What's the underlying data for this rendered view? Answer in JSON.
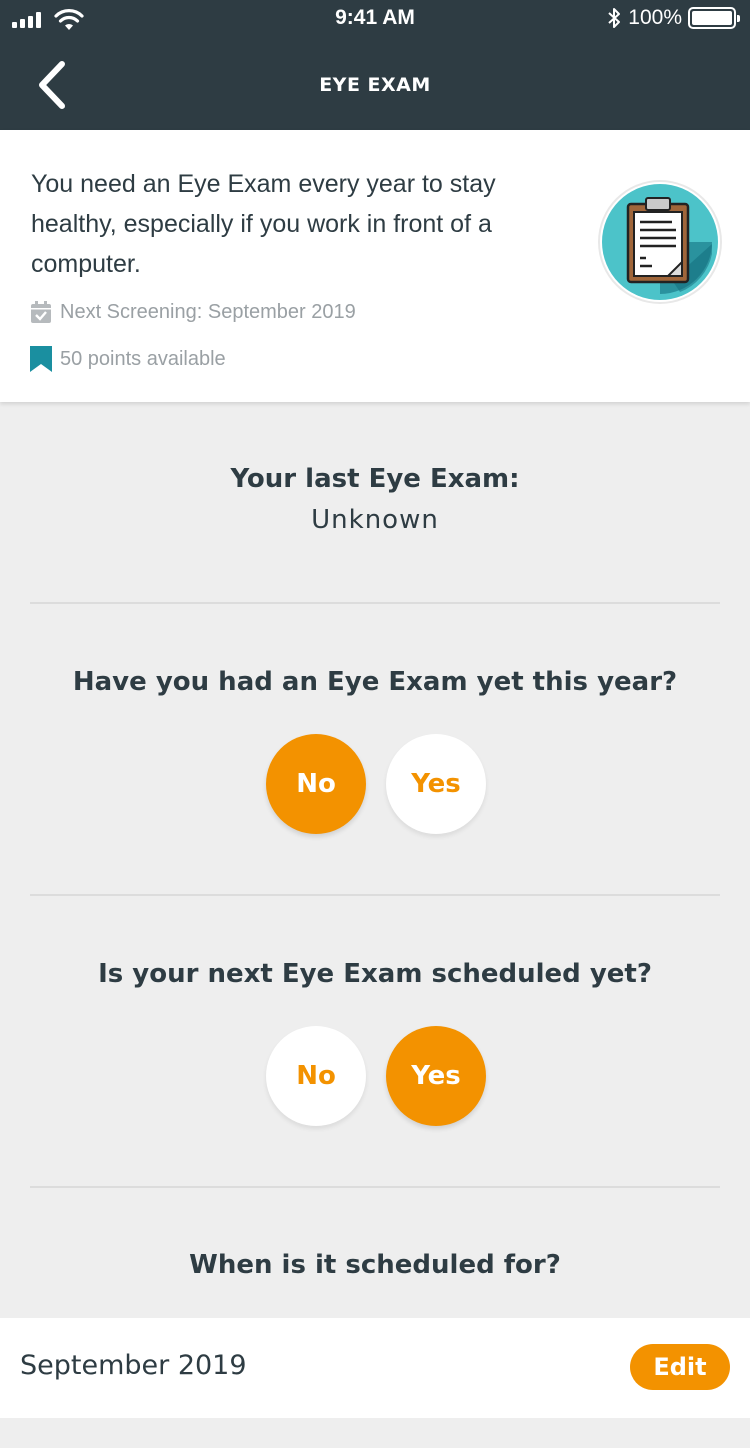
{
  "status_bar": {
    "time": "9:41 AM",
    "battery": "100%",
    "icons": [
      "signal-icon",
      "wifi-icon",
      "bluetooth-icon",
      "battery-icon"
    ]
  },
  "nav": {
    "title": "EYE EXAM",
    "back_icon": "chevron-left-icon"
  },
  "intro": {
    "description": "You need an Eye Exam every year to stay healthy, especially if you work in front of a computer.",
    "next_screening": "Next Screening: September 2019",
    "points": "50 points available",
    "badge_icon": "clipboard-icon"
  },
  "last_exam": {
    "label": "Your last Eye Exam:",
    "value": "Unknown"
  },
  "question1": {
    "text": "Have you had an Eye Exam yet this year?",
    "no": "No",
    "yes": "Yes",
    "selected": "No"
  },
  "question2": {
    "text": "Is your next Eye Exam scheduled yet?",
    "no": "No",
    "yes": "Yes",
    "selected": "Yes"
  },
  "question3": {
    "text": "When is it scheduled for?",
    "date": "September 2019",
    "edit": "Edit"
  },
  "colors": {
    "header": "#2e3c43",
    "accent": "#f39200",
    "badge_circle": "#4cc3c9",
    "bookmark": "#1a8fa0"
  }
}
